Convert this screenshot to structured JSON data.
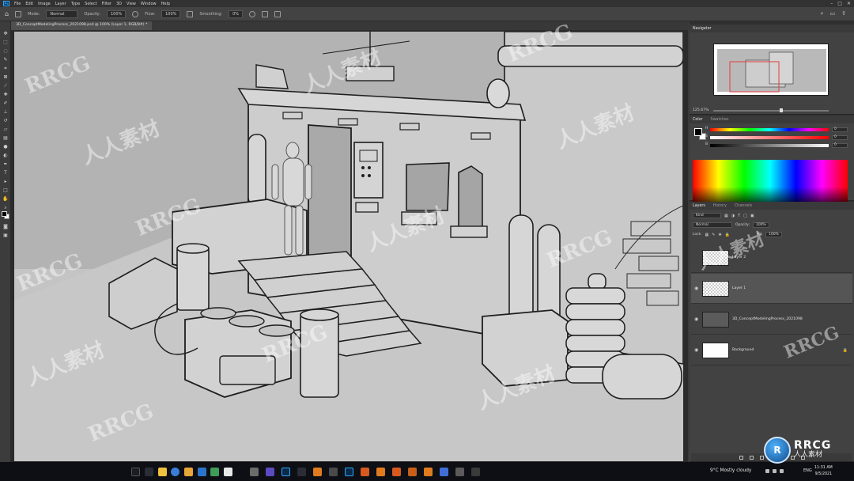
{
  "menubar": {
    "logo": "Ps",
    "items": [
      "File",
      "Edit",
      "Image",
      "Layer",
      "Type",
      "Select",
      "Filter",
      "3D",
      "View",
      "Window",
      "Help"
    ]
  },
  "options": {
    "mode_label": "Mode:",
    "mode_value": "Normal",
    "opacity_label": "Opacity:",
    "opacity_value": "100%",
    "flow_label": "Flow:",
    "flow_value": "100%",
    "smoothing_label": "Smoothing:",
    "smoothing_value": "0%"
  },
  "document": {
    "tab_title": "3D_ConceptModelingProcess_2021098.psd @ 100% (Layer 1, RGB/8#) *"
  },
  "panels": {
    "navigator": {
      "tabs": [
        "Navigator"
      ],
      "zoom": "125.67%"
    },
    "color": {
      "tabs": [
        "Color",
        "Swatches"
      ],
      "slider_labels": [
        "H",
        "S",
        "B"
      ],
      "values": [
        "0",
        "0",
        "0"
      ]
    },
    "layers": {
      "tabs": [
        "Layers",
        "History",
        "Channels"
      ],
      "filter_label": "Kind",
      "blend_mode": "Normal",
      "opacity_label": "Opacity:",
      "opacity_value": "100%",
      "lock_label": "Lock:",
      "fill_label": "Fill:",
      "fill_value": "100%",
      "items": [
        {
          "name": "Layer 2"
        },
        {
          "name": "Layer 1"
        },
        {
          "name": "3D_ConceptModelingProcess_2021098"
        },
        {
          "name": "Background"
        }
      ]
    }
  },
  "taskbar": {
    "weather": "9°C  Mostly cloudy",
    "language": "ENG",
    "time": "11:31 AM",
    "date": "9/5/2021"
  },
  "watermark": {
    "text_latin": "RRCG",
    "text_cjk": "人人素材",
    "badge_letter": "R",
    "badge_title": "RRCG",
    "badge_sub": "人人素材"
  },
  "colors": {
    "accent": "#31a8ff",
    "canvas_bg": "#b9b9b9",
    "panel_bg": "#424242",
    "taskbar_bg": "#0d0f14"
  }
}
